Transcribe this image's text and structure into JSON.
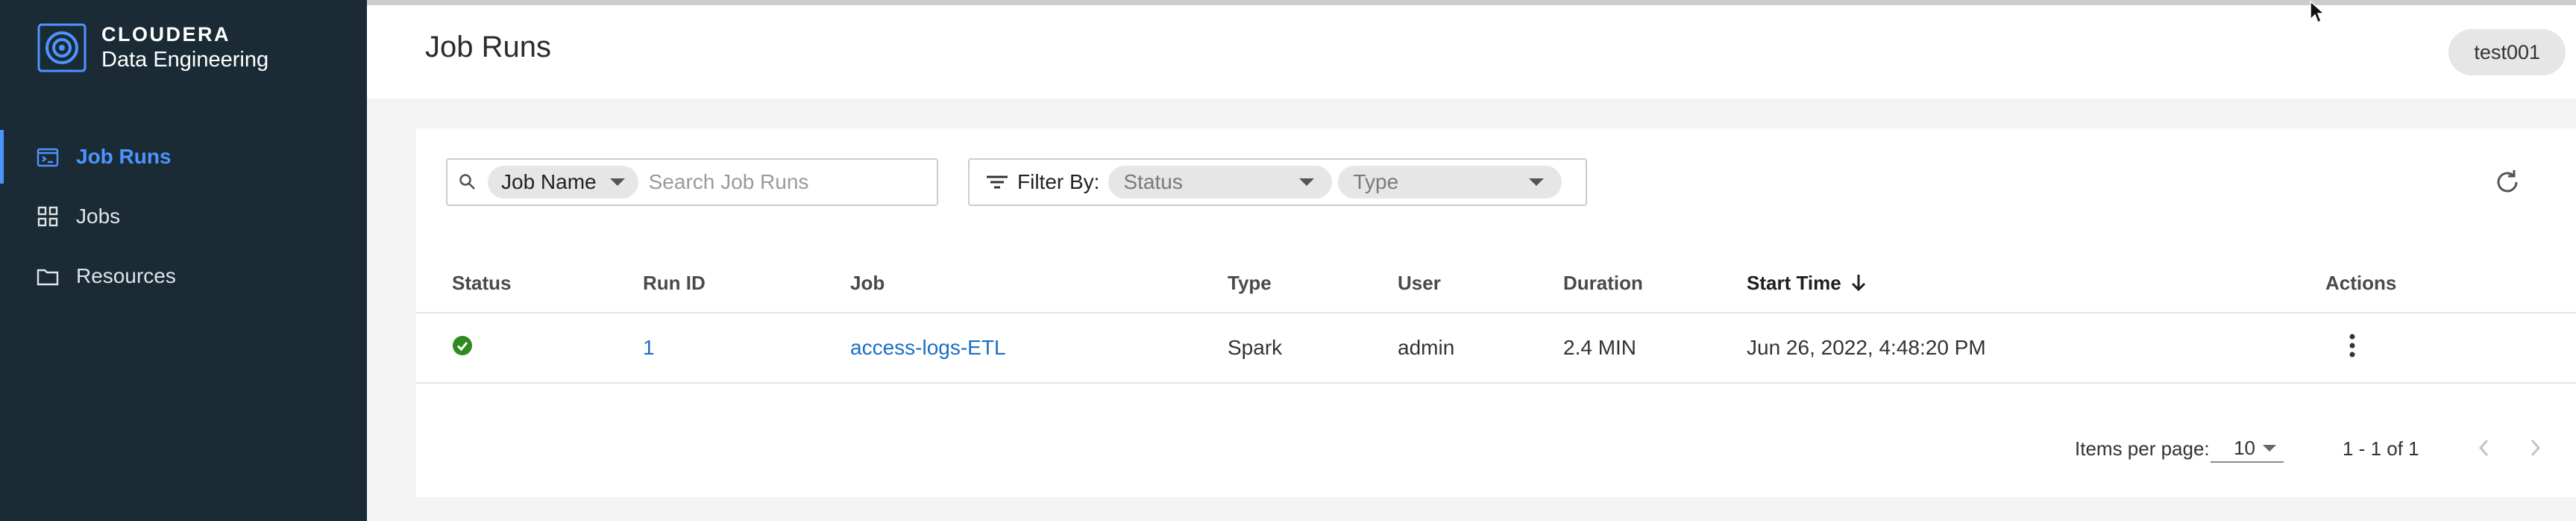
{
  "brand": {
    "name": "CLOUDERA",
    "product": "Data Engineering"
  },
  "sidebar": {
    "items": [
      {
        "label": "Job Runs",
        "icon": "job-runs-icon",
        "active": true
      },
      {
        "label": "Jobs",
        "icon": "grid-icon",
        "active": false
      },
      {
        "label": "Resources",
        "icon": "folder-icon",
        "active": false
      }
    ]
  },
  "header": {
    "title": "Job Runs",
    "user": "test001"
  },
  "search": {
    "field_chip": "Job Name",
    "placeholder": "Search Job Runs",
    "value": ""
  },
  "filter": {
    "label": "Filter By:",
    "status_placeholder": "Status",
    "type_placeholder": "Type"
  },
  "table": {
    "columns": {
      "status": "Status",
      "run_id": "Run ID",
      "job": "Job",
      "type": "Type",
      "user": "User",
      "duration": "Duration",
      "start_time": "Start Time",
      "actions": "Actions"
    },
    "sorted_by": "start_time",
    "sort_direction": "descending",
    "rows": [
      {
        "status": "success",
        "run_id": "1",
        "job": "access-logs-ETL",
        "type": "Spark",
        "user": "admin",
        "duration": "2.4 MIN",
        "start_time": "Jun 26, 2022, 4:48:20 PM"
      }
    ]
  },
  "pagination": {
    "items_per_page_label": "Items per page:",
    "items_per_page": "10",
    "range": "1 - 1 of 1"
  },
  "colors": {
    "sidebar_bg": "#1a2b35",
    "accent": "#4d94ff",
    "link": "#1a6fc4",
    "success": "#2e8b1f"
  }
}
